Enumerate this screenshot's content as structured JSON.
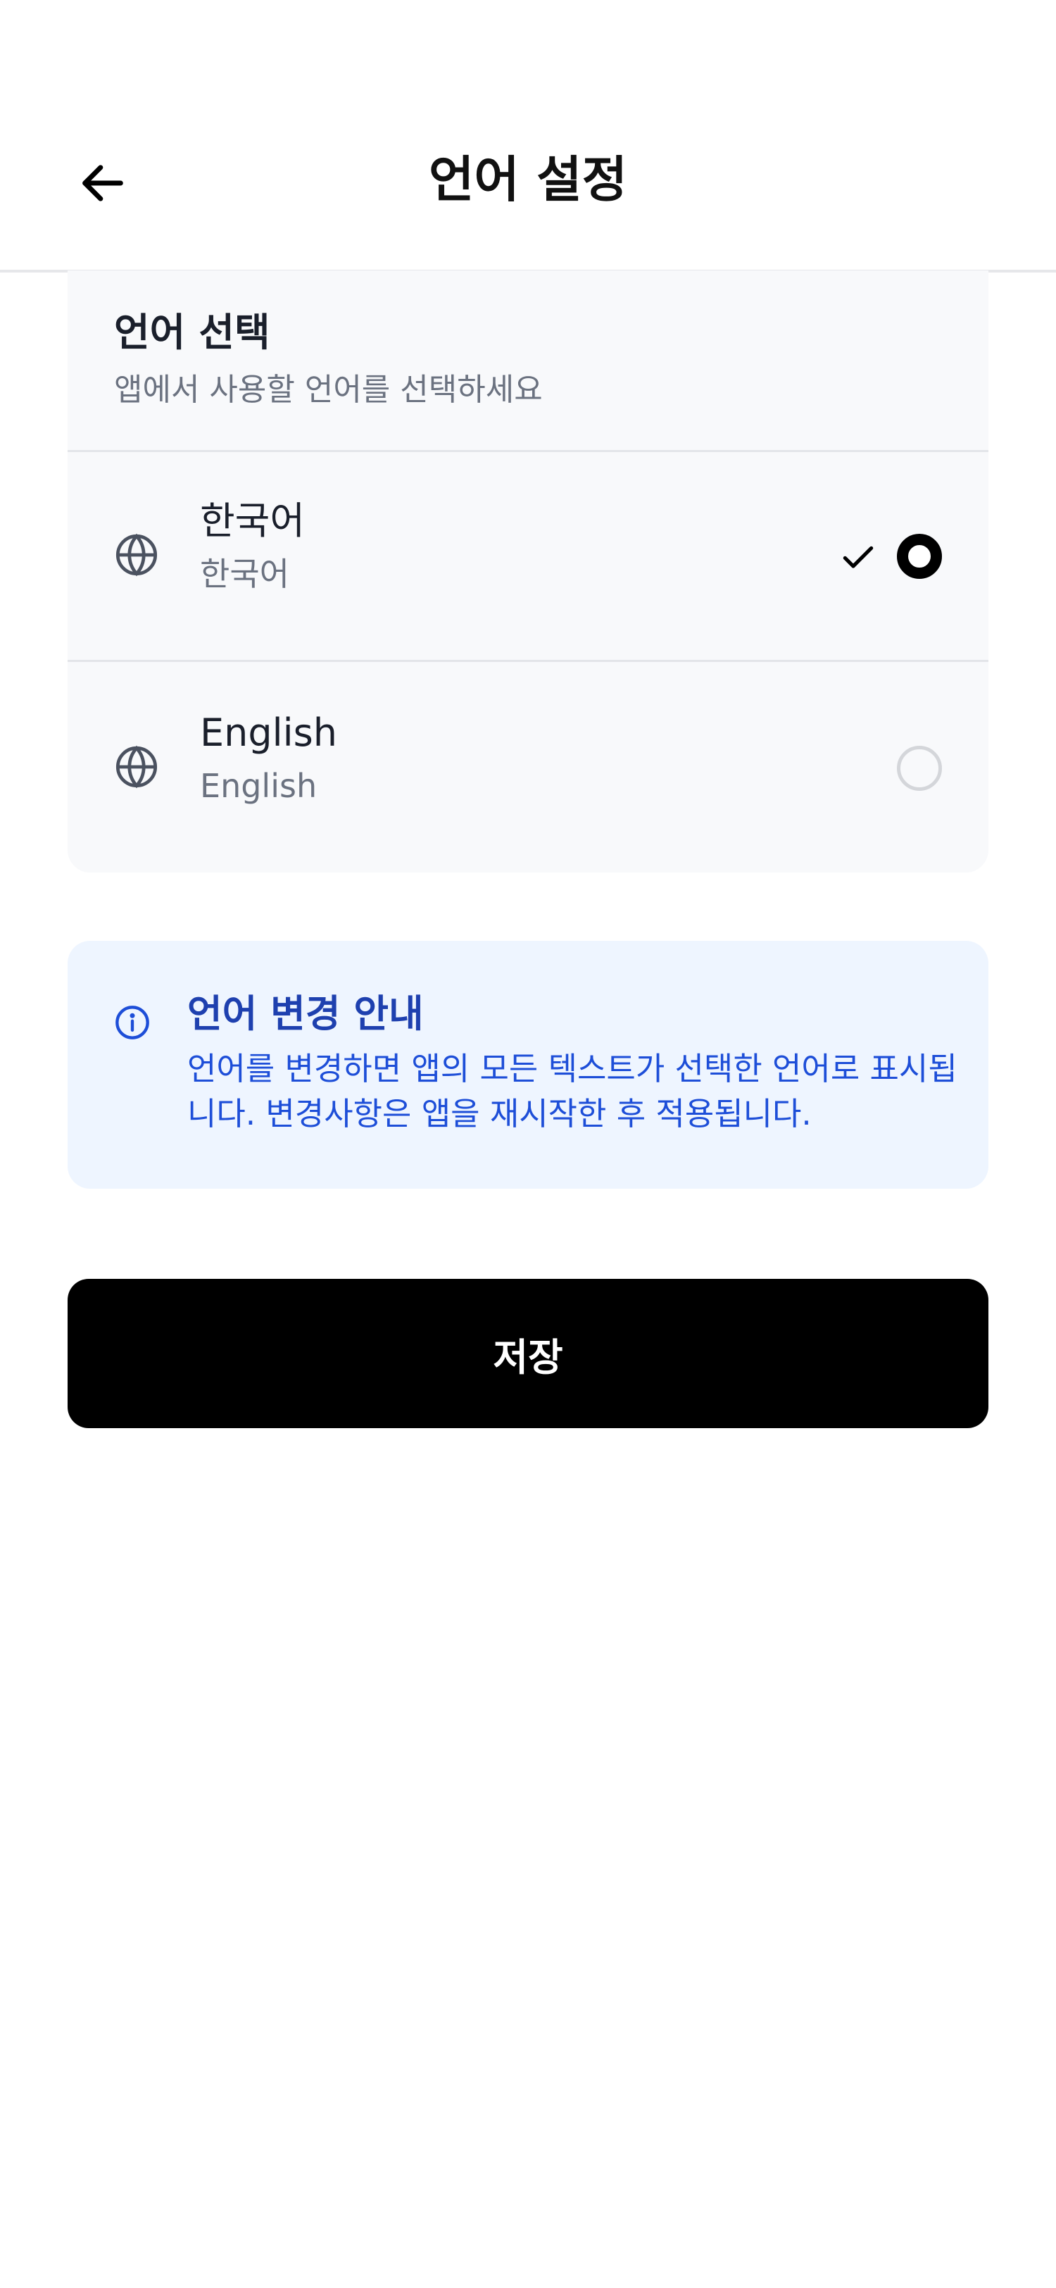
{
  "header": {
    "title": "언어 설정",
    "back_icon": "arrow-left-icon"
  },
  "language_card": {
    "title": "언어 선택",
    "subtitle": "앱에서 사용할 언어를 선택하세요",
    "options": [
      {
        "name": "한국어",
        "native": "한국어",
        "selected": true,
        "icon": "globe-icon"
      },
      {
        "name": "English",
        "native": "English",
        "selected": false,
        "icon": "globe-icon"
      }
    ]
  },
  "info": {
    "icon": "info-icon",
    "title": "언어 변경 안내",
    "body": "언어를 변경하면 앱의 모든 텍스트가 선택한 언어로 표시됩니다. 변경사항은 앱을 재시작한 후 적용됩니다."
  },
  "actions": {
    "save_label": "저장"
  },
  "colors": {
    "accent": "#000000",
    "info_background": "#eef5ff",
    "info_text": "#1d4ed8",
    "card_background": "#f8f9fb"
  }
}
